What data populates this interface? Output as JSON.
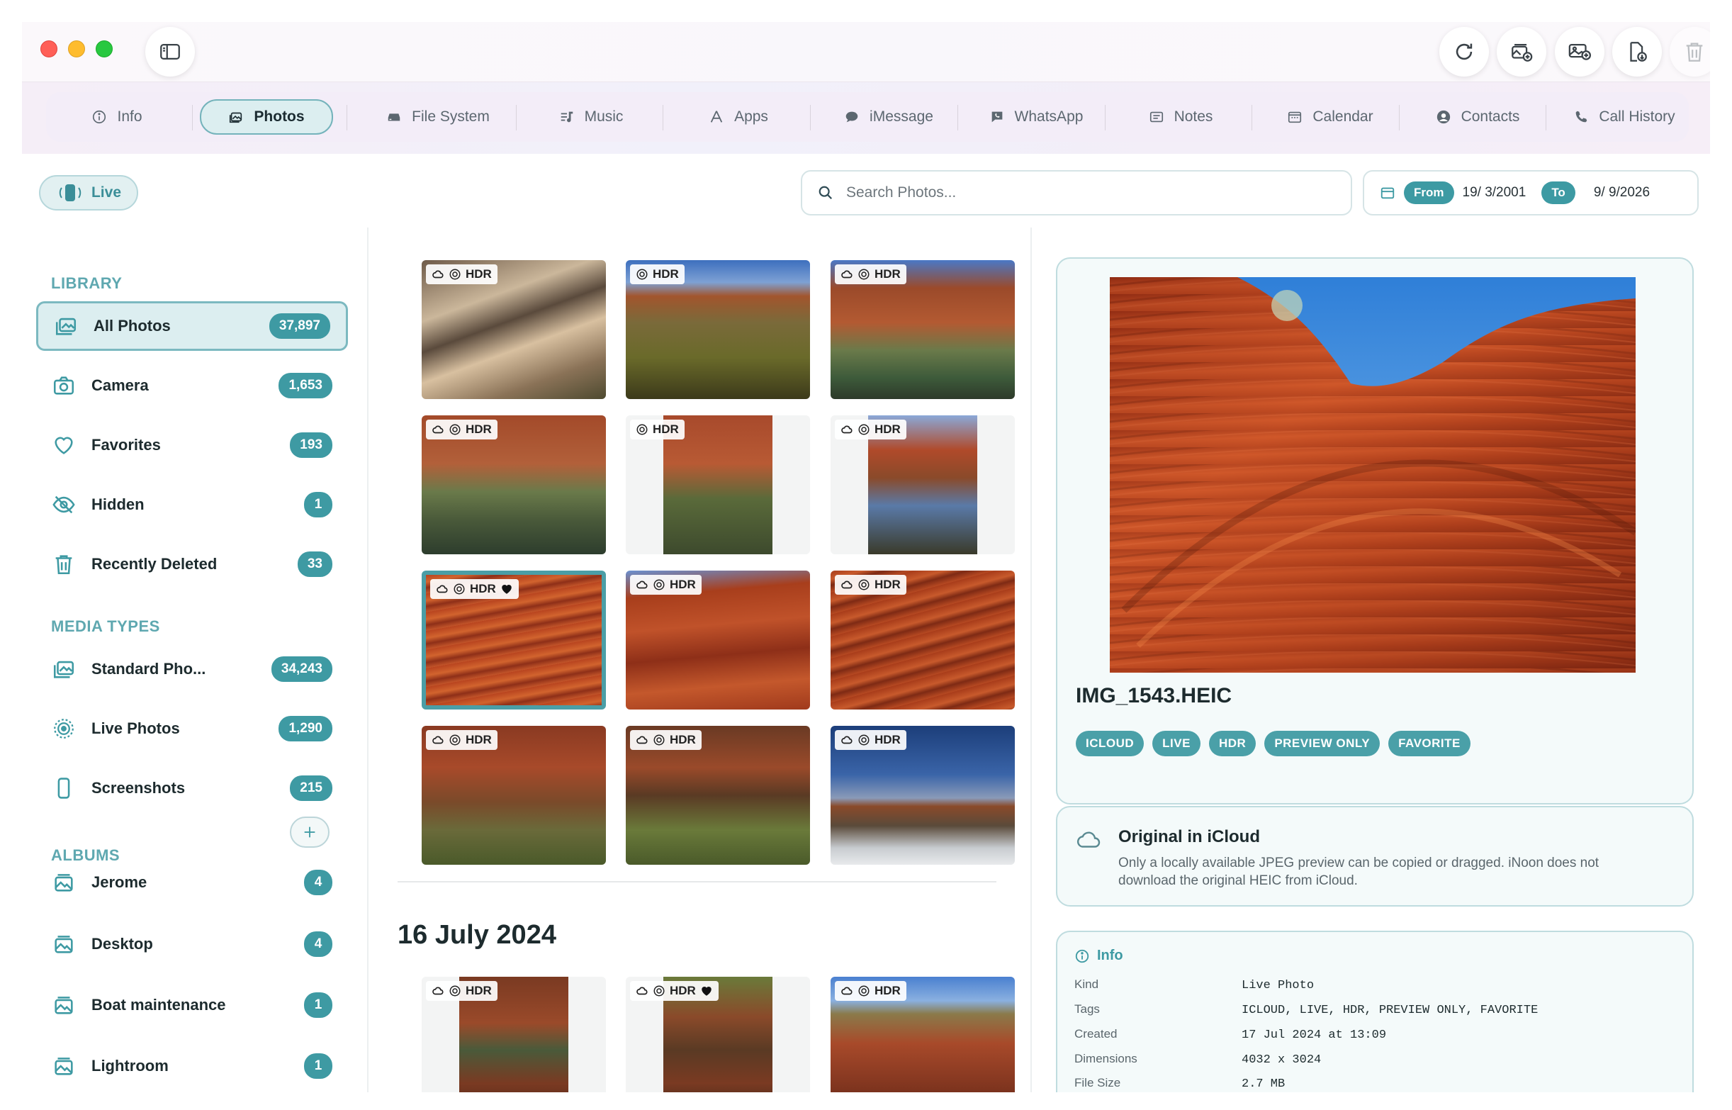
{
  "tabs": [
    {
      "label": "Info",
      "icon": "info-icon"
    },
    {
      "label": "Photos",
      "icon": "photos-icon",
      "active": true
    },
    {
      "label": "File System",
      "icon": "drive-icon"
    },
    {
      "label": "Music",
      "icon": "music-icon"
    },
    {
      "label": "Apps",
      "icon": "apps-icon"
    },
    {
      "label": "iMessage",
      "icon": "message-icon"
    },
    {
      "label": "WhatsApp",
      "icon": "whatsapp-icon"
    },
    {
      "label": "Notes",
      "icon": "notes-icon"
    },
    {
      "label": "Calendar",
      "icon": "calendar-icon"
    },
    {
      "label": "Contacts",
      "icon": "contacts-icon"
    },
    {
      "label": "Call History",
      "icon": "phone-icon"
    }
  ],
  "toolbar": {
    "live_label": "Live",
    "search_placeholder": "Search Photos...",
    "from_label": "From",
    "from_date": "19/ 3/2001",
    "to_label": "To",
    "to_date": "9/ 9/2026"
  },
  "sidebar": {
    "library_title": "LIBRARY",
    "library": [
      {
        "label": "All Photos",
        "count": "37,897",
        "icon": "photos-icon",
        "active": true
      },
      {
        "label": "Camera",
        "count": "1,653",
        "icon": "camera-icon"
      },
      {
        "label": "Favorites",
        "count": "193",
        "icon": "heart-icon"
      },
      {
        "label": "Hidden",
        "count": "1",
        "icon": "eye-slash-icon"
      },
      {
        "label": "Recently Deleted",
        "count": "33",
        "icon": "trash-icon"
      }
    ],
    "media_title": "MEDIA TYPES",
    "media": [
      {
        "label": "Standard Pho...",
        "count": "34,243",
        "icon": "photos-icon"
      },
      {
        "label": "Live Photos",
        "count": "1,290",
        "icon": "live-photo-icon"
      },
      {
        "label": "Screenshots",
        "count": "215",
        "icon": "phone-device-icon"
      }
    ],
    "albums_title": "ALBUMS",
    "albums": [
      {
        "label": "Jerome",
        "count": "4",
        "icon": "album-icon"
      },
      {
        "label": "Desktop",
        "count": "4",
        "icon": "album-icon"
      },
      {
        "label": "Boat maintenance",
        "count": "1",
        "icon": "album-icon"
      },
      {
        "label": "Lightroom",
        "count": "1",
        "icon": "album-icon"
      }
    ]
  },
  "grid": {
    "badge_text": "HDR",
    "date_heading": "16 July 2024"
  },
  "detail": {
    "filename": "IMG_1543.HEIC",
    "tags": [
      "ICLOUD",
      "LIVE",
      "HDR",
      "PREVIEW ONLY",
      "FAVORITE"
    ],
    "icloud_title": "Original in iCloud",
    "icloud_text": "Only a locally available JPEG preview can be copied or dragged. iNoon does not download the original HEIC from iCloud.",
    "info_title": "Info",
    "info": [
      {
        "key": "Kind",
        "value": "Live Photo"
      },
      {
        "key": "Tags",
        "value": "ICLOUD, LIVE, HDR, PREVIEW ONLY, FAVORITE"
      },
      {
        "key": "Created",
        "value": "17 Jul 2024 at 13:09"
      },
      {
        "key": "Dimensions",
        "value": "4032 x 3024"
      },
      {
        "key": "File Size",
        "value": "2.7 MB"
      }
    ]
  },
  "colors": {
    "accent": "#3e9aa3",
    "accent_light": "#dceef0",
    "section": "#5fa8b0"
  }
}
